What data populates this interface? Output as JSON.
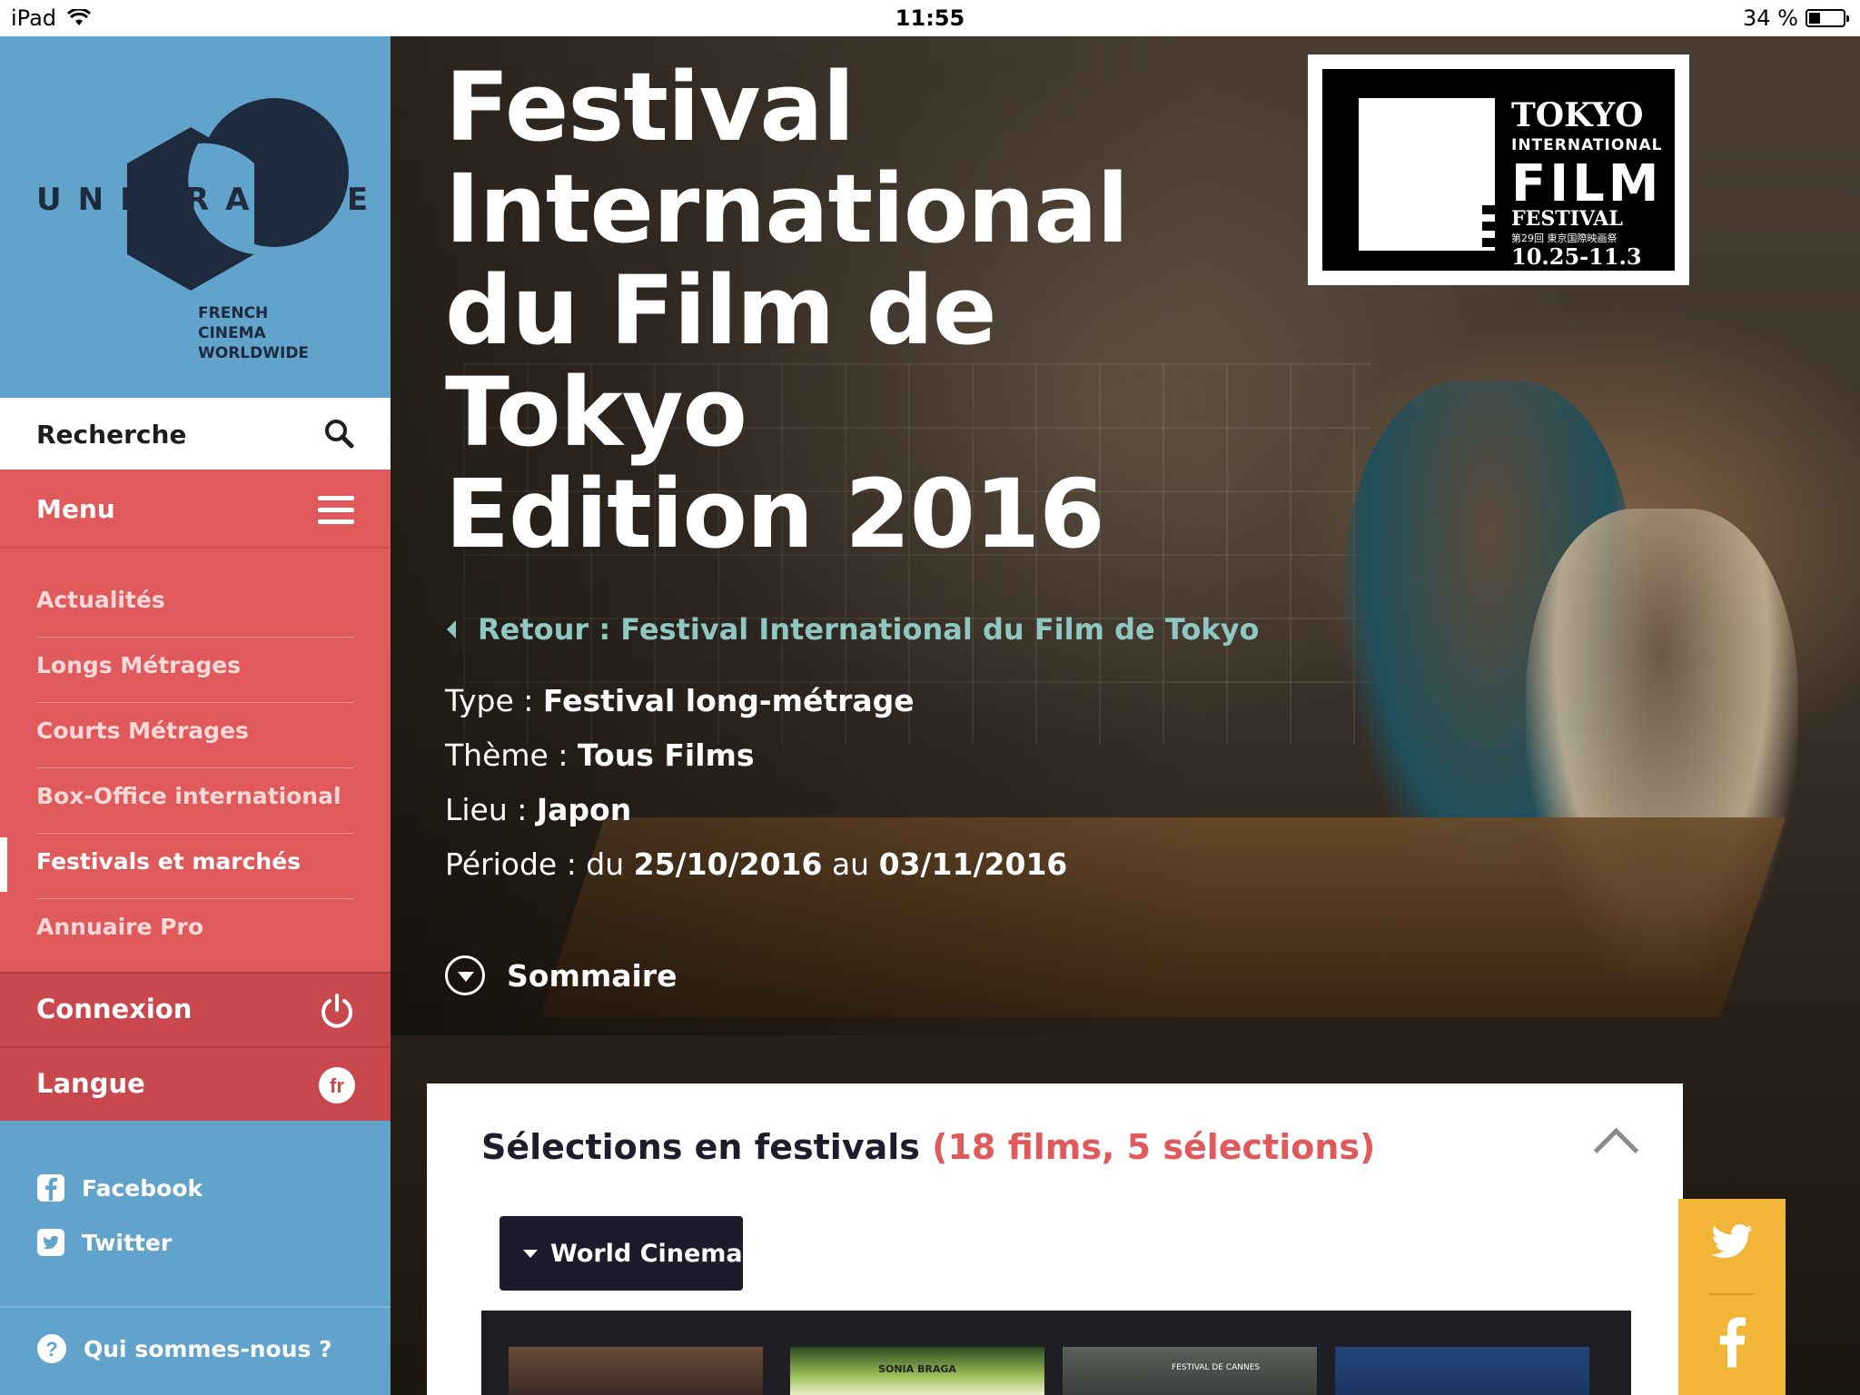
{
  "status_bar": {
    "device": "iPad",
    "time": "11:55",
    "battery": "34 %"
  },
  "sidebar": {
    "logo": {
      "wordmark": "UNIFRANCE",
      "tagline": [
        "FRENCH",
        "CINEMA",
        "WORLDWIDE"
      ]
    },
    "search_label": "Recherche",
    "menu_label": "Menu",
    "menu_items": [
      {
        "label": "Actualités"
      },
      {
        "label": "Longs Métrages"
      },
      {
        "label": "Courts Métrages"
      },
      {
        "label": "Box-Office international"
      },
      {
        "label": "Festivals et marchés",
        "active": true
      },
      {
        "label": "Annuaire Pro"
      }
    ],
    "connexion_label": "Connexion",
    "langue_label": "Langue",
    "langue_code": "fr",
    "social": [
      {
        "label": "Facebook",
        "icon": "facebook-icon"
      },
      {
        "label": "Twitter",
        "icon": "twitter-icon"
      }
    ],
    "about_label": "Qui sommes-nous ?"
  },
  "hero": {
    "title_lines": [
      "Festival",
      "International",
      "du Film de",
      "Tokyo",
      "Edition 2016"
    ],
    "back_link": "Retour : Festival International du Film de Tokyo",
    "meta": {
      "type_key": "Type : ",
      "type_val": "Festival long-métrage",
      "theme_key": "Thème : ",
      "theme_val": "Tous Films",
      "lieu_key": "Lieu : ",
      "lieu_val": "Japon",
      "periode_key": "Période : du ",
      "periode_from": "25/10/2016",
      "periode_mid": " au ",
      "periode_to": "03/11/2016"
    },
    "sommaire_label": "Sommaire",
    "festival_logo": {
      "line1": "TOKYO",
      "line2": "INTERNATIONAL",
      "line3": "FILM",
      "line4": "FESTIVAL",
      "line5": "第29回 東京国際映画祭",
      "line6": "10.25-11.3"
    }
  },
  "content": {
    "heading": "Sélections en festivals ",
    "count": "(18 films, 5 sélections)",
    "dropdown_selected": "World Cinema",
    "posters": [
      {
        "caption": ""
      },
      {
        "caption": "SONIA BRAGA"
      },
      {
        "caption": "FESTIVAL DE CANNES"
      },
      {
        "caption": ""
      }
    ]
  },
  "colors": {
    "sidebar_blue": "#62a3cb",
    "menu_red": "#e05a5c",
    "share_yellow": "#f2b538",
    "dark_navy": "#1c1b2b",
    "link_teal": "#8fc7c3"
  }
}
